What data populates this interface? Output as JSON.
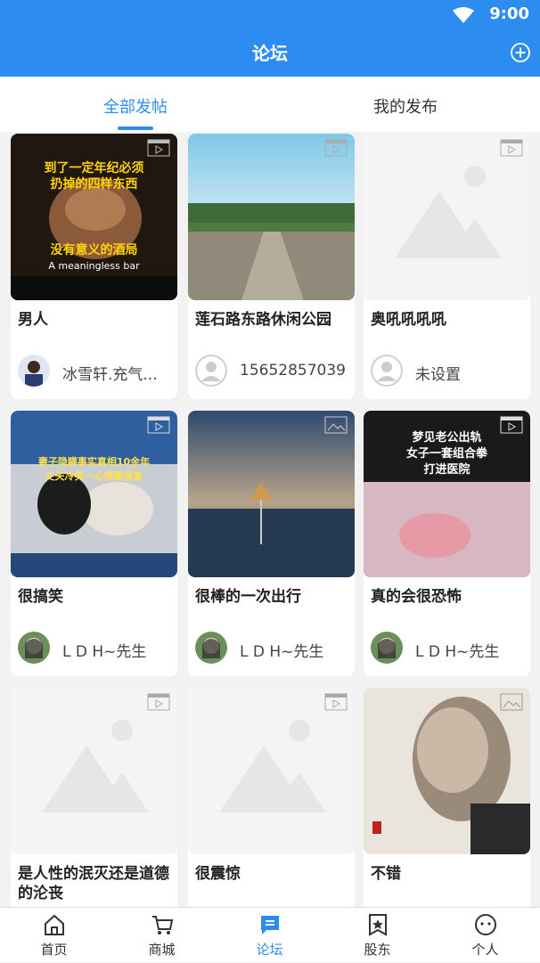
{
  "status_bar": {
    "time": "9:00"
  },
  "header": {
    "title": "论坛"
  },
  "tabs": [
    {
      "label": "全部发帖",
      "active": true
    },
    {
      "label": "我的发布",
      "active": false
    }
  ],
  "posts": [
    {
      "title": "男人",
      "author": "冰雪轩.充气...",
      "media": "video",
      "thumb_text": [
        "到了一定年纪必须",
        "扔掉的四样东西",
        "没有意义的酒局",
        "A meaningless bar"
      ]
    },
    {
      "title": "莲石路东路休闲公园",
      "author": "15652857039",
      "media": "video"
    },
    {
      "title": "奥吼吼吼吼",
      "author": "未设置",
      "media": "video"
    },
    {
      "title": "很搞笑",
      "author": "L D H~先生",
      "media": "video",
      "thumb_text": [
        "妻子隐瞒事实真相10余年",
        "丈夫冷笑一心想要报复"
      ]
    },
    {
      "title": "很棒的一次出行",
      "author": "L D H~先生",
      "media": "image"
    },
    {
      "title": "真的会很恐怖",
      "author": "L D H~先生",
      "media": "video",
      "thumb_text": [
        "梦见老公出轨",
        "女子一套组合拳",
        "打进医院"
      ]
    },
    {
      "title": "是人性的泯灭还是道德的沦丧",
      "author": "",
      "media": "video"
    },
    {
      "title": "很震惊",
      "author": "",
      "media": "video"
    },
    {
      "title": "不错",
      "author": "",
      "media": "image"
    }
  ],
  "bottom_nav": [
    {
      "label": "首页",
      "icon": "home-icon",
      "active": false
    },
    {
      "label": "商城",
      "icon": "cart-icon",
      "active": false
    },
    {
      "label": "论坛",
      "icon": "forum-icon",
      "active": true
    },
    {
      "label": "股东",
      "icon": "shareholder-icon",
      "active": false
    },
    {
      "label": "个人",
      "icon": "profile-icon",
      "active": false
    }
  ],
  "colors": {
    "primary": "#2d8cf0",
    "background": "#f2f2f2"
  }
}
